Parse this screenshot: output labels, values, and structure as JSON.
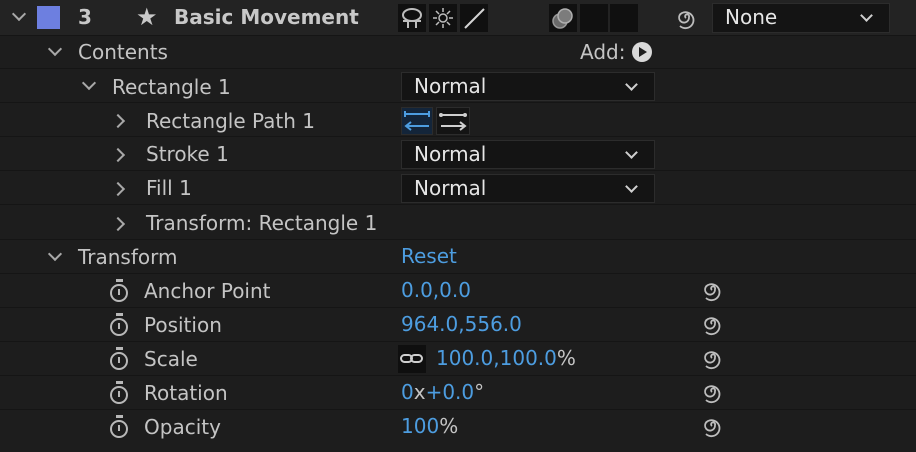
{
  "layer": {
    "number": "3",
    "name": "Basic Movement",
    "color_swatch": "#6d7fe0",
    "blend_mode": "None"
  },
  "contents": {
    "label": "Contents",
    "add_label": "Add:"
  },
  "rectangle": {
    "label": "Rectangle 1",
    "blend": "Normal"
  },
  "rectangle_path": {
    "label": "Rectangle Path 1"
  },
  "stroke": {
    "label": "Stroke 1",
    "blend": "Normal"
  },
  "fill": {
    "label": "Fill 1",
    "blend": "Normal"
  },
  "transform_rect": {
    "label": "Transform: Rectangle 1"
  },
  "transform": {
    "label": "Transform",
    "reset_label": "Reset",
    "properties": [
      {
        "name": "Anchor Point",
        "value": "0.0,0.0",
        "suffix": ""
      },
      {
        "name": "Position",
        "value": "964.0,556.0",
        "suffix": ""
      },
      {
        "name": "Scale",
        "value": "100.0,100.0",
        "suffix": "%"
      },
      {
        "name": "Rotation",
        "value_a": "0",
        "sep": "x",
        "value_b": "+0.0",
        "suffix": "°"
      },
      {
        "name": "Opacity",
        "value": "100",
        "suffix": "%"
      }
    ]
  },
  "colors": {
    "accent_blue": "#4d9de0",
    "background": "#1d1d1d"
  }
}
